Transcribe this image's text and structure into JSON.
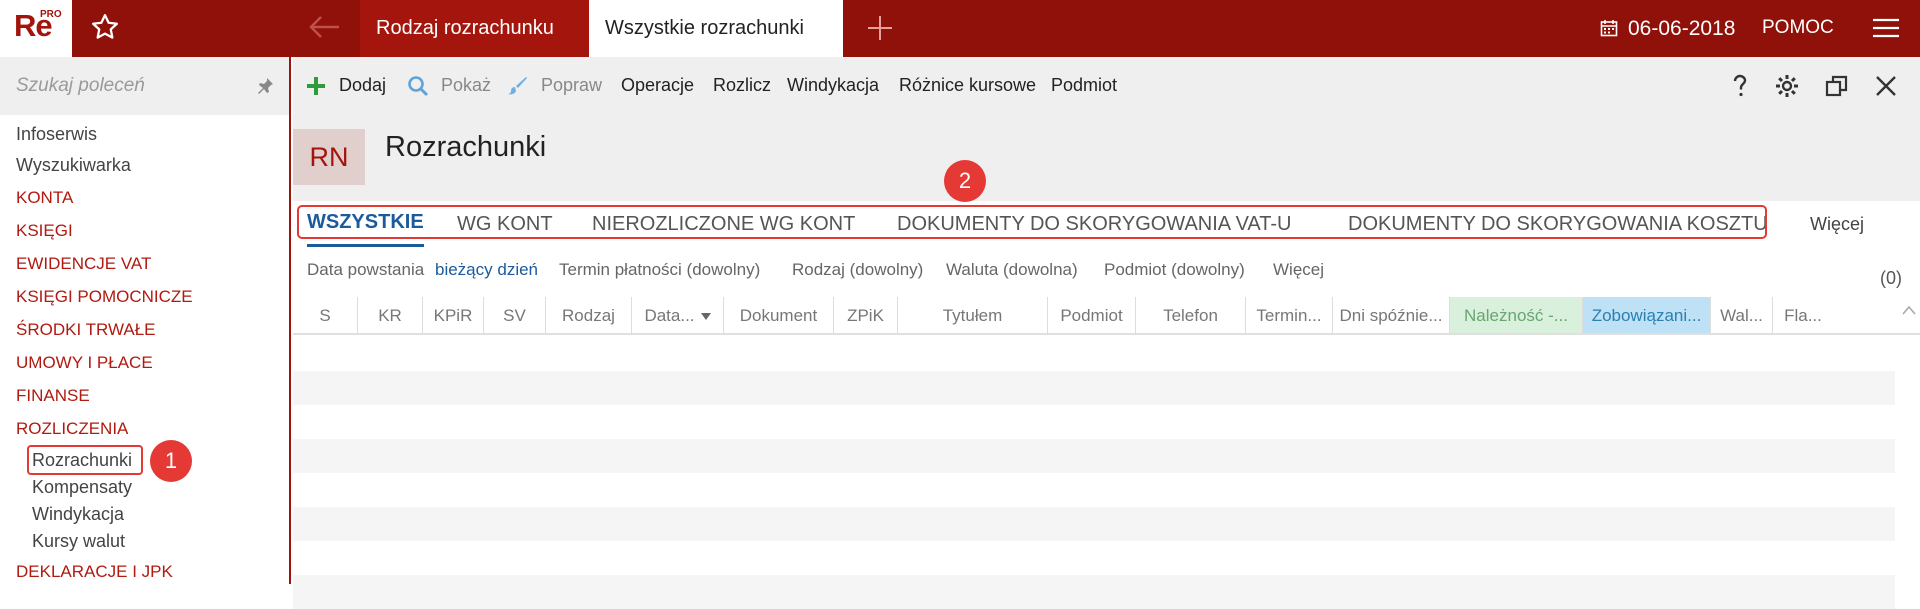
{
  "app": {
    "logo": "Re",
    "logo_sup": "PRO",
    "tabs": [
      {
        "label": "Rodzaj rozrachunku"
      },
      {
        "label": "Wszystkie rozrachunki"
      }
    ],
    "date": "06-06-2018",
    "help": "POMOC"
  },
  "sidebar": {
    "search_placeholder": "Szukaj poleceń",
    "items": [
      {
        "label": "Infoserwis"
      },
      {
        "label": "Wyszukiwarka"
      },
      {
        "label": "KONTA"
      },
      {
        "label": "KSIĘGI"
      },
      {
        "label": "EWIDENCJE VAT"
      },
      {
        "label": "KSIĘGI POMOCNICZE"
      },
      {
        "label": "ŚRODKI TRWAŁE"
      },
      {
        "label": "UMOWY I PŁACE"
      },
      {
        "label": "FINANSE"
      },
      {
        "label": "ROZLICZENIA"
      },
      {
        "label": "Rozrachunki"
      },
      {
        "label": "Kompensaty"
      },
      {
        "label": "Windykacja"
      },
      {
        "label": "Kursy walut"
      },
      {
        "label": "DEKLARACJE I JPK"
      }
    ],
    "badge": "1"
  },
  "toolbar": {
    "add": "Dodaj",
    "show": "Pokaż",
    "edit": "Popraw",
    "operations": "Operacje",
    "settle": "Rozlicz",
    "collection": "Windykacja",
    "fx_diff": "Różnice kursowe",
    "entity": "Podmiot"
  },
  "header": {
    "code": "RN",
    "title": "Rozrachunki"
  },
  "subtabs": {
    "items": [
      {
        "label": "WSZYSTKIE"
      },
      {
        "label": "WG KONT"
      },
      {
        "label": "NIEROZLICZONE WG KONT"
      },
      {
        "label": "DOKUMENTY DO SKORYGOWANIA VAT-U"
      },
      {
        "label": "DOKUMENTY DO SKORYGOWANIA KOSZTU"
      }
    ],
    "more": "Więcej",
    "badge": "2"
  },
  "filters": {
    "date_label": "Data powstania",
    "date_value": "bieżący dzień",
    "due": "Termin płatności (dowolny)",
    "kind": "Rodzaj (dowolny)",
    "currency": "Waluta (dowolna)",
    "entity": "Podmiot (dowolny)",
    "more": "Więcej",
    "count": "(0)"
  },
  "grid": {
    "columns": [
      "S",
      "KR",
      "KPiR",
      "SV",
      "Rodzaj",
      "Data...",
      "Dokument",
      "ZPiK",
      "Tytułem",
      "Podmiot",
      "Telefon",
      "Termin...",
      "Dni spóźnie...",
      "Należność -...",
      "Zobowiązani...",
      "Wal...",
      "Fla..."
    ]
  },
  "colors": {
    "brand": "#8f1109",
    "accent_blue": "#1b5a9c",
    "badge": "#e53935"
  }
}
